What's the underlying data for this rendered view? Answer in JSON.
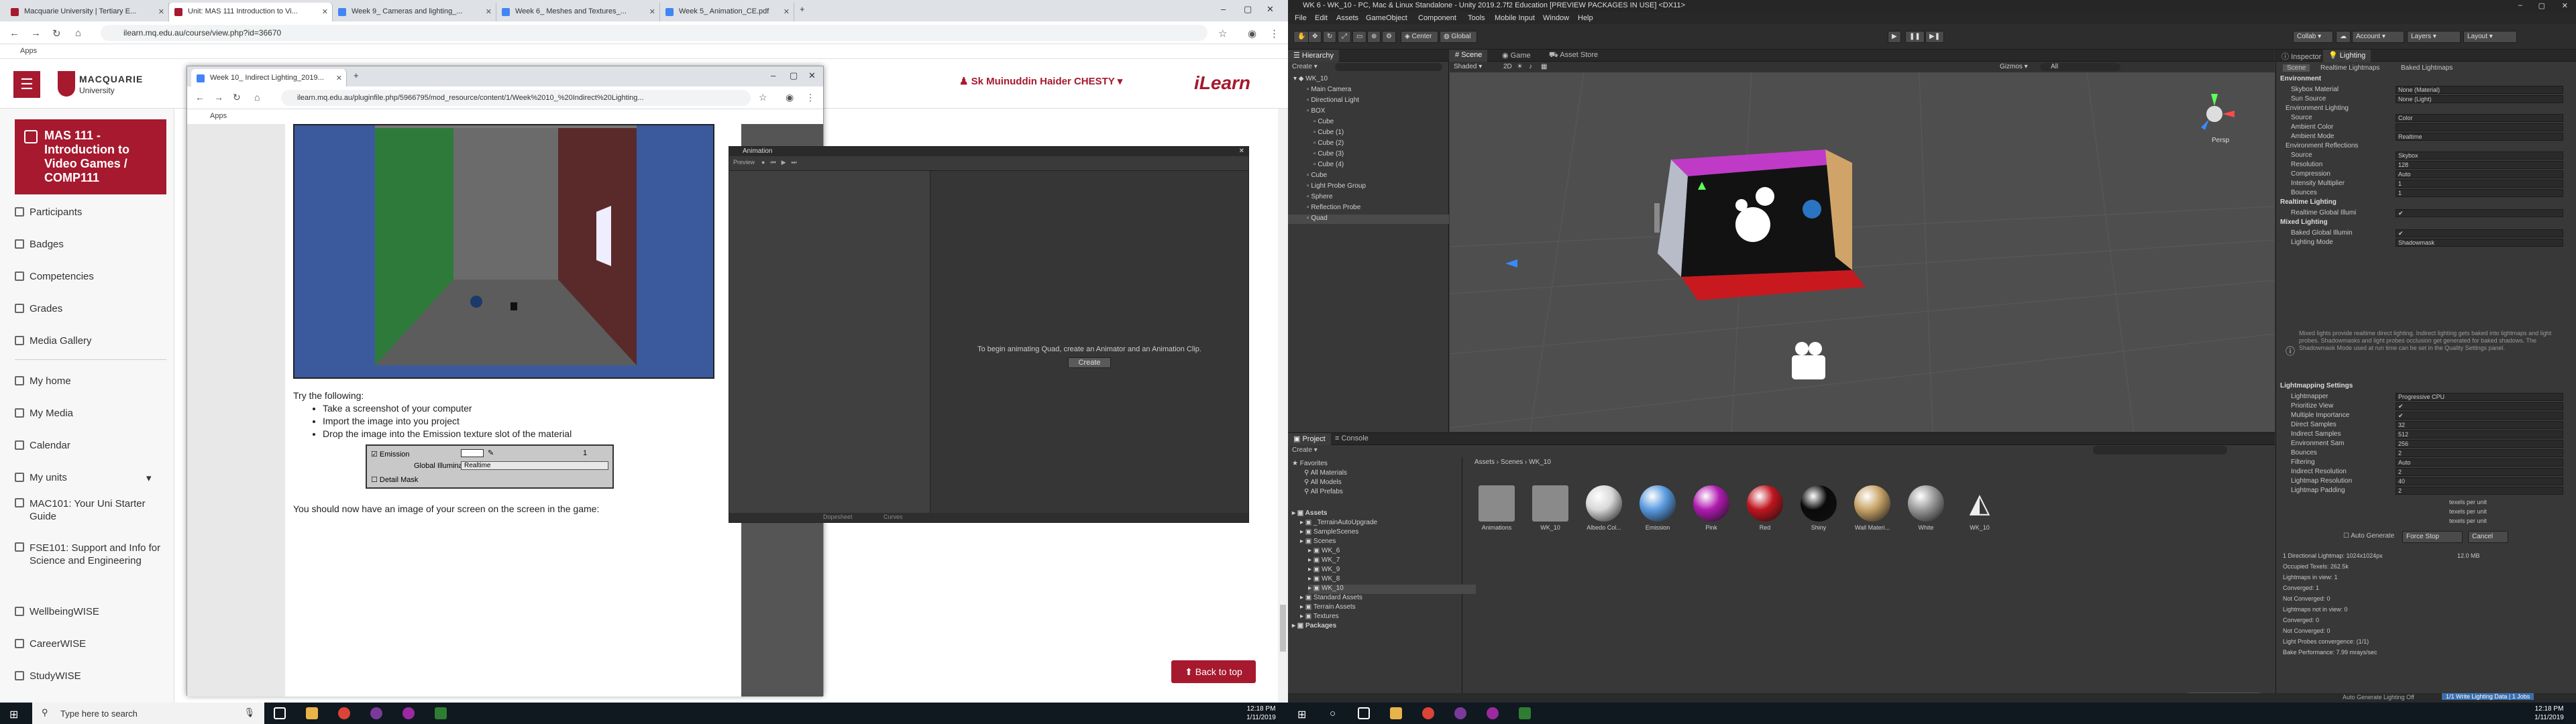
{
  "chrome": {
    "tabs": [
      {
        "title": "Macquarie University | Tertiary E...",
        "color": "#a6192e"
      },
      {
        "title": "Unit: MAS 111 Introduction to Vi...",
        "color": "#a6192e"
      },
      {
        "title": "Week 9_ Cameras and lighting_...",
        "color": "#4285f4"
      },
      {
        "title": "Week 6_ Meshes and Textures_...",
        "color": "#4285f4"
      },
      {
        "title": "Week 5_ Animation_CE.pdf",
        "color": "#4285f4"
      }
    ],
    "url": "ilearn.mq.edu.au/course/view.php?id=36670",
    "bookmarks_label": "Apps"
  },
  "ilearn": {
    "university": "MACQUARIE",
    "university_sub": "University",
    "user_name": "Sk Muinuddin Haider CHESTY",
    "brand": "iLearn",
    "course_title": "MAS 111 - Introduction to Video Games / COMP111",
    "nav": [
      "Participants",
      "Badges",
      "Competencies",
      "Grades",
      "Media Gallery"
    ],
    "nav2": [
      "My home",
      "My Media",
      "Calendar",
      "My units"
    ],
    "units": [
      "MAC101: Your Uni Starter Guide",
      "FSE101: Support and Info for Science and Engineering",
      "WellbeingWISE",
      "CareerWISE",
      "StudyWISE"
    ],
    "back_to_top": "Back to top"
  },
  "popup": {
    "tab_title": "Week 10_ Indirect Lighting_2019...",
    "url": "ilearn.mq.edu.au/pluginfile.php/5966795/mod_resource/content/1/Week%2010_%20Indirect%20Lighting...",
    "bookmarks_label": "Apps",
    "intro": "Try the following:",
    "steps": [
      "Take a screenshot of your computer",
      "Import the image into you project",
      "Drop the image into the Emission texture slot of the material"
    ],
    "mat_emission": "Emission",
    "mat_global": "Global Illuminati",
    "mat_global_val": "Realtime",
    "mat_detail": "Detail Mask",
    "mat_value": "1",
    "outro": "You should now have an image of your screen on the screen in the game:"
  },
  "animation": {
    "title": "Animation",
    "preview": "Preview",
    "message": "To begin animating Quad, create an Animator and an Animation Clip.",
    "create": "Create",
    "dopesheet": "Dopesheet",
    "curves": "Curves"
  },
  "taskbar": {
    "search_placeholder": "Type here to search",
    "time": "12:18 PM",
    "date": "1/11/2019"
  },
  "unity": {
    "title": "WK 6 - WK_10 - PC, Mac & Linux Standalone - Unity 2019.2.7f2 Education [PREVIEW PACKAGES IN USE] <DX11>",
    "menu": [
      "File",
      "Edit",
      "Assets",
      "GameObject",
      "Component",
      "Tools",
      "Mobile Input",
      "Window",
      "Help"
    ],
    "pivot": "Center",
    "space": "Global",
    "collab": "Collab",
    "account": "Account",
    "layers": "Layers",
    "layout": "Layout",
    "hierarchy_tab": "Hierarchy",
    "create": "Create",
    "hierarchy": [
      {
        "name": "WK_10",
        "indent": 0
      },
      {
        "name": "Main Camera",
        "indent": 2
      },
      {
        "name": "Directional Light",
        "indent": 2
      },
      {
        "name": "BOX",
        "indent": 2
      },
      {
        "name": "Cube",
        "indent": 3
      },
      {
        "name": "Cube (1)",
        "indent": 3
      },
      {
        "name": "Cube (2)",
        "indent": 3
      },
      {
        "name": "Cube (3)",
        "indent": 3
      },
      {
        "name": "Cube (4)",
        "indent": 3
      },
      {
        "name": "Cube",
        "indent": 2
      },
      {
        "name": "Light Probe Group",
        "indent": 2
      },
      {
        "name": "Sphere",
        "indent": 2
      },
      {
        "name": "Reflection Probe",
        "indent": 2
      },
      {
        "name": "Quad",
        "indent": 2
      }
    ],
    "scene_tabs": [
      "Scene",
      "Game",
      "Asset Store"
    ],
    "shading": "Shaded",
    "mode_2d": "2D",
    "gizmos": "Gizmos",
    "search_all": "All",
    "persp": "Persp",
    "inspector_tabs": [
      "Inspector",
      "Lighting"
    ],
    "lighting_tabs": [
      "Scene",
      "Realtime Lightmaps",
      "Baked Lightmaps"
    ],
    "lighting_rows": [
      {
        "type": "head",
        "label": "Environment"
      },
      {
        "label": "Skybox Material",
        "value": "None (Material)"
      },
      {
        "label": "Sun Source",
        "value": "None (Light)"
      },
      {
        "type": "sub",
        "label": "Environment Lighting"
      },
      {
        "label": "Source",
        "value": "Color"
      },
      {
        "label": "Ambient Color",
        "value": ""
      },
      {
        "label": "Ambient Mode",
        "value": "Realtime"
      },
      {
        "type": "sub",
        "label": "Environment Reflections"
      },
      {
        "label": "Source",
        "value": "Skybox"
      },
      {
        "label": "Resolution",
        "value": "128"
      },
      {
        "label": "Compression",
        "value": "Auto"
      },
      {
        "label": "Intensity Multiplier",
        "value": "1"
      },
      {
        "label": "Bounces",
        "value": "1"
      },
      {
        "type": "head",
        "label": "Realtime Lighting"
      },
      {
        "label": "Realtime Global Illumi",
        "value": "✔"
      },
      {
        "type": "head",
        "label": "Mixed Lighting"
      },
      {
        "label": "Baked Global Illumin",
        "value": "✔"
      },
      {
        "label": "Lighting Mode",
        "value": "Shadowmask"
      }
    ],
    "mixed_note": "Mixed lights provide realtime direct lighting. Indirect lighting gets baked into lightmaps and light probes. Shadowmasks and light probes occlusion get generated for baked shadows. The Shadowmask Mode used at run time can be set in the Quality Settings panel.",
    "lightmap_rows": [
      {
        "type": "head",
        "label": "Lightmapping Settings"
      },
      {
        "label": "Lightmapper",
        "value": "Progressive CPU"
      },
      {
        "label": "Prioritize View",
        "value": "✔"
      },
      {
        "label": "Multiple Importance",
        "value": "✔"
      },
      {
        "label": "Direct Samples",
        "value": "32"
      },
      {
        "label": "Indirect Samples",
        "value": "512"
      },
      {
        "label": "Environment Sam",
        "value": "256"
      },
      {
        "label": "Bounces",
        "value": "2"
      },
      {
        "label": "Filtering",
        "value": "Auto"
      },
      {
        "label": "Indirect Resolution",
        "value": "2"
      },
      {
        "label": "Lightmap Resolution",
        "value": "40"
      },
      {
        "label": "Lightmap Padding",
        "value": "2"
      }
    ],
    "texels_unit": "texels per unit",
    "auto_generate": "Auto Generate",
    "force_stop": "Force Stop",
    "cancel": "Cancel",
    "stats": [
      "1 Directional Lightmap: 1024x1024px",
      "12.0 MB",
      "Occupied Texels: 262.5k",
      "Lightmaps in view: 1",
      "Converged: 1",
      "Not Converged: 0",
      "Lightmaps not in view: 0",
      "Converged: 0",
      "Not Converged: 0",
      "Light Probes convergence: (1/1)",
      "Bake Performance: 7.99 mrays/sec"
    ],
    "status_right": "Auto Generate Lighting Off",
    "status_btn": "1/1 Write Lighting Data | 1 Jobs",
    "project_tabs": [
      "Project",
      "Console"
    ],
    "favorites": [
      "Favorites",
      "All Materials",
      "All Models",
      "All Prefabs"
    ],
    "assets_tree": [
      {
        "name": "Assets",
        "indent": 0,
        "bold": true
      },
      {
        "name": "_TerrainAutoUpgrade",
        "indent": 1
      },
      {
        "name": "SampleScenes",
        "indent": 1
      },
      {
        "name": "Scenes",
        "indent": 1
      },
      {
        "name": "WK_6",
        "indent": 2
      },
      {
        "name": "WK_7",
        "indent": 2
      },
      {
        "name": "WK_9",
        "indent": 2
      },
      {
        "name": "WK_8",
        "indent": 2
      },
      {
        "name": "WK_10",
        "indent": 2
      },
      {
        "name": "Standard Assets",
        "indent": 1
      },
      {
        "name": "Terrain Assets",
        "indent": 1
      },
      {
        "name": "Textures",
        "indent": 1
      },
      {
        "name": "Packages",
        "indent": 0,
        "bold": true
      }
    ],
    "breadcrumb": "Assets › Scenes › WK_10",
    "assets": [
      {
        "name": "Animations",
        "kind": "folder",
        "color": "#8a8a8a"
      },
      {
        "name": "WK_10",
        "kind": "folder",
        "color": "#8a8a8a"
      },
      {
        "name": "Albedo Col...",
        "kind": "sphere",
        "color": "#d8d8d8"
      },
      {
        "name": "Emission",
        "kind": "sphere",
        "color": "#5a9be0"
      },
      {
        "name": "Pink",
        "kind": "sphere",
        "color": "#b01ab0"
      },
      {
        "name": "Red",
        "kind": "sphere",
        "color": "#c0141e"
      },
      {
        "name": "Shiny",
        "kind": "sphere",
        "color": "#0a0a0a"
      },
      {
        "name": "Wall Materi...",
        "kind": "sphere",
        "color": "#c8a468"
      },
      {
        "name": "White",
        "kind": "sphere",
        "color": "#9a9a9a"
      },
      {
        "name": "WK_10",
        "kind": "unity",
        "color": "#eeeeee"
      }
    ]
  },
  "taskbar2": {
    "time": "12:18 PM",
    "date": "1/11/2019"
  }
}
